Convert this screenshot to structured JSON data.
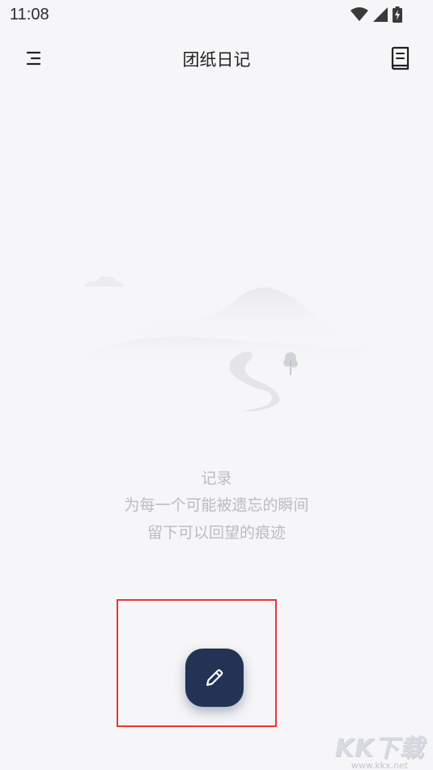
{
  "status_bar": {
    "time": "11:08",
    "icons": [
      "wifi-icon",
      "signal-icon",
      "battery-charging-icon"
    ]
  },
  "header": {
    "title": "团纸日记",
    "left_icon": "menu-icon",
    "right_icon": "book-icon"
  },
  "empty_state": {
    "illustration": "landscape-illustration",
    "line1": "记录",
    "line2": "为每一个可能被遗忘的瞬间",
    "line3": "留下可以回望的痕迹"
  },
  "fab": {
    "icon": "pencil-icon",
    "accent_color": "#223355"
  },
  "annotation": {
    "highlight_color": "#e23a36"
  },
  "watermark": {
    "logo": "KK下载",
    "url": "www.kkx.net"
  }
}
